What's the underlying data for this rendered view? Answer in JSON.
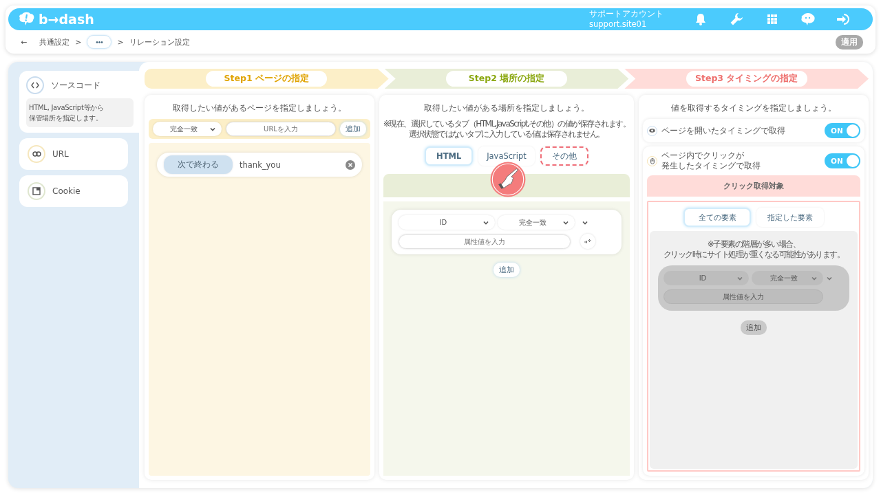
{
  "header": {
    "logo": "b→dash",
    "account_label": "サポートアカウント",
    "account_id": "support.site01"
  },
  "breadcrumb": {
    "back": "←",
    "first": "共通設定",
    "separator_1": ">",
    "more": "•••",
    "separator_2": ">",
    "current": "リレーション設定"
  },
  "apply_button": {
    "label": "適用",
    "disabled": true
  },
  "sidebar": {
    "items": [
      {
        "kind": "code",
        "label": "ソースコード",
        "selected": true,
        "description_lines": [
          "HTML, JavaScript等から",
          "保管場所を指定します。"
        ]
      },
      {
        "kind": "link",
        "label": "URL",
        "selected": false
      },
      {
        "kind": "window",
        "label": "Cookie",
        "selected": false
      }
    ]
  },
  "steps": [
    {
      "label": "Step1 ページの指定",
      "color": "#fcefc8"
    },
    {
      "label": "Step2 場所の指定",
      "color": "#e9eed8"
    },
    {
      "label": "Step3 タイミングの指定",
      "color": "#ffdcd9"
    }
  ],
  "page_panel": {
    "heading": "取得したい値があるページを指定しましょう。",
    "match_select": "完全一致",
    "url_placeholder": "URLを入力",
    "add_button": "追加",
    "conditions": [
      {
        "match": "次で終わる",
        "value": "thank_you"
      }
    ]
  },
  "location_panel": {
    "heading": "取得したい値がある場所を指定しましょう。",
    "note_lines": [
      "※現在、選択しているタブ（HTML,JavaScript,その他）の値が保存されます。",
      "選択状態ではないタブに入力している値は保存されません。"
    ],
    "tabs": [
      {
        "label": "HTML",
        "selected": true,
        "highlighted": false
      },
      {
        "label": "JavaScript",
        "selected": false,
        "highlighted": false
      },
      {
        "label": "その他",
        "selected": false,
        "highlighted": true
      }
    ],
    "attribute_select": "ID",
    "match_select": "完全一致",
    "value_placeholder": "属性値を入力",
    "add_button": "追加"
  },
  "timing_panel": {
    "heading": "値を取得するタイミングを指定しましょう。",
    "options": [
      {
        "kind": "view",
        "label_lines": [
          "ページを開いたタイミングで取得"
        ],
        "toggle": "ON",
        "on": true
      },
      {
        "kind": "click",
        "label_lines": [
          "ページ内でクリックが",
          "発生したタイミングで取得"
        ],
        "toggle": "ON",
        "on": true
      }
    ],
    "click_target": {
      "title": "クリック取得対象",
      "tabs": [
        {
          "label": "全ての要素",
          "selected": true
        },
        {
          "label": "指定した要素",
          "selected": false
        }
      ],
      "note_lines": [
        "※子要素の階層が多い場合、",
        "クリック時にサイト処理が重くなる可能性があります。"
      ],
      "attribute_select": "ID",
      "match_select": "完全一致",
      "value_placeholder": "属性値を入力",
      "add_button": "追加",
      "disabled": true
    }
  }
}
